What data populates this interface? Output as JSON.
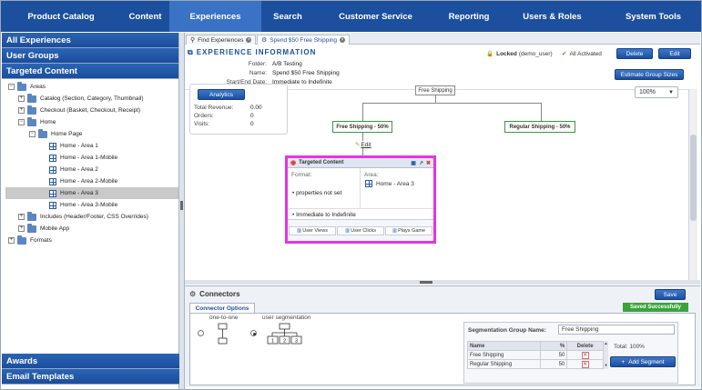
{
  "nav": {
    "items": [
      "Product Catalog",
      "Content",
      "Experiences",
      "Search",
      "Customer Service",
      "Reporting",
      "Users & Roles",
      "System Tools"
    ],
    "active_index": 2
  },
  "sidebar": {
    "all_experiences": "All Experiences",
    "user_groups": "User Groups",
    "targeted_content": "Targeted Content",
    "tree": {
      "areas": "Areas",
      "catalog": "Catalog (Section, Category, Thumbnail)",
      "checkout": "Checkout (Basket, Checkout, Receipt)",
      "home": "Home",
      "home_page": "Home Page",
      "area1": "Home - Area 1",
      "area1m": "Home - Area 1-Mobile",
      "area2": "Home - Area 2",
      "area2m": "Home - Area 2-Mobile",
      "area3": "Home - Area 3",
      "area3m": "Home - Area 3-Mobile",
      "includes": "Includes (Header/Footer, CSS Overrides)",
      "mobile_app": "Mobile App",
      "formats": "Formats"
    },
    "awards": "Awards",
    "email_templates": "Email Templates"
  },
  "tabs": [
    "Find Experiences",
    "Spend $50 Free Shipping"
  ],
  "experience": {
    "header": "EXPERIENCE INFORMATION",
    "folder_label": "Folder:",
    "folder": "A/B Testing",
    "name_label": "Name:",
    "name": "Spend $50 Free Shipping",
    "dates_label": "Start/End Date:",
    "dates": "Immediate to Indefinite",
    "locked": "Locked",
    "locked_user": "(demo_user)",
    "activated": "All Activated",
    "delete": "Delete",
    "edit": "Edit",
    "estimate": "Estimate Group Sizes"
  },
  "stats": {
    "analytics": "Analytics",
    "revenue_label": "Total Revenue:",
    "revenue": "0.00",
    "orders_label": "Orders:",
    "orders": "0",
    "visits_label": "Visits:",
    "visits": "0"
  },
  "zoom": "100%",
  "flow": {
    "root": "Free Shipping",
    "left": "Free Shipping - 50%",
    "right": "Regular Shipping - 50%",
    "edit_link": "Edit"
  },
  "tc": {
    "title": "Targeted Content",
    "format_label": "Format:",
    "area_label": "Area:",
    "area_value": "Home - Area 3",
    "properties": "properties not set",
    "schedule": "Immediate to Indefinite",
    "links": [
      "User Views",
      "User Clicks",
      "Plays Game"
    ]
  },
  "connectors": {
    "title": "Connectors",
    "save": "Save",
    "saved": "Saved Successfully",
    "options_tab": "Connector Options",
    "one_to_one": "one-to-one",
    "user_seg": "user segmentation",
    "seg_group_label": "Segmentation Group Name:",
    "seg_group_name": "Free Shipping",
    "col_name": "Name",
    "col_pct": "%",
    "col_delete": "Delete",
    "rows": [
      {
        "name": "Free Shipping",
        "pct": "50"
      },
      {
        "name": "Regular Shipping",
        "pct": "50"
      }
    ],
    "total": "Total: 100%",
    "add_segment": "Add Segment"
  }
}
